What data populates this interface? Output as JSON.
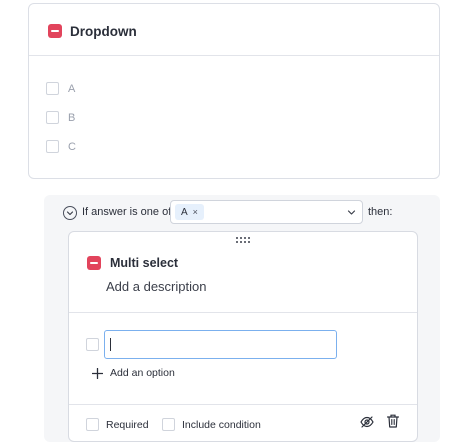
{
  "dropdown_card": {
    "title": "Dropdown",
    "options": [
      "A",
      "B",
      "C"
    ]
  },
  "condition": {
    "prefix_text": "If answer is one of",
    "selected_tag": "A",
    "tag_remove_icon": "×",
    "suffix_text": "then:"
  },
  "multi_select_card": {
    "title": "Multi select",
    "description": "Add a description",
    "option_input_value": "",
    "add_option_label": "Add an option",
    "required_label": "Required",
    "include_condition_label": "Include condition"
  },
  "colors": {
    "badge": "#e2445c",
    "tag_bg": "#e6f0fc",
    "input_focus_border": "#7bb0ee",
    "section_bg": "#f5f6f8"
  },
  "icons": {
    "badge": "minus-square-icon",
    "toggle": "chevron-down-circle-icon",
    "select": "chevron-down-icon",
    "drag": "drag-handle-icon",
    "add": "plus-icon",
    "visibility": "eye-off-icon",
    "delete": "trash-icon"
  }
}
